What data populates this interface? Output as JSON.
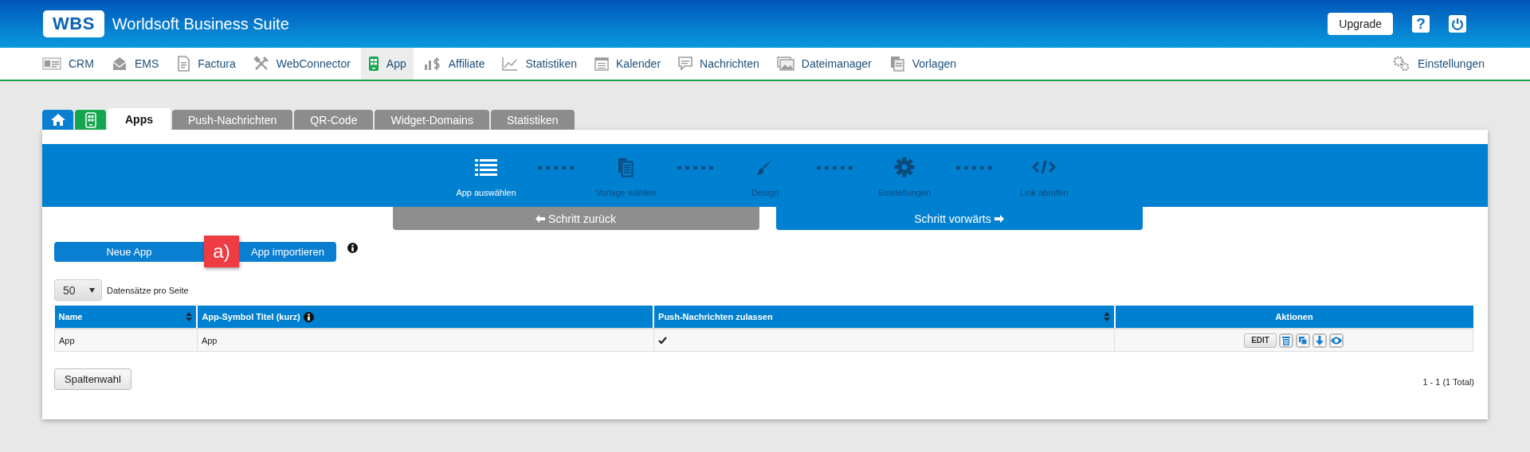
{
  "header": {
    "logo": "WBS",
    "title": "Worldsoft Business Suite",
    "upgrade": "Upgrade",
    "help": "?"
  },
  "nav": {
    "items": [
      {
        "label": "CRM",
        "kind": "card",
        "selected": false
      },
      {
        "label": "EMS",
        "kind": "mail",
        "selected": false
      },
      {
        "label": "Factura",
        "kind": "invoice",
        "selected": false
      },
      {
        "label": "WebConnector",
        "kind": "tools",
        "selected": false
      },
      {
        "label": "App",
        "kind": "phone",
        "selected": true
      },
      {
        "label": "Affiliate",
        "kind": "bars",
        "selected": false
      },
      {
        "label": "Statistiken",
        "kind": "chart",
        "selected": false
      },
      {
        "label": "Kalender",
        "kind": "calendar",
        "selected": false
      },
      {
        "label": "Nachrichten",
        "kind": "chat",
        "selected": false
      },
      {
        "label": "Dateimanager",
        "kind": "images",
        "selected": false
      },
      {
        "label": "Vorlagen",
        "kind": "docs",
        "selected": false
      }
    ],
    "settings": "Einstellungen"
  },
  "tabs": [
    {
      "kind": "home",
      "color": "#0a7fd2",
      "selected": false
    },
    {
      "kind": "phone",
      "color": "#17a650",
      "selected": false
    },
    {
      "kind": "text",
      "label": "Apps",
      "selected": true
    },
    {
      "kind": "text",
      "label": "Push-Nachrichten",
      "selected": false
    },
    {
      "kind": "text",
      "label": "QR-Code",
      "selected": false
    },
    {
      "kind": "text",
      "label": "Widget-Domains",
      "selected": false
    },
    {
      "kind": "text",
      "label": "Statistiken",
      "selected": false
    }
  ],
  "wizard": {
    "steps": [
      {
        "kind": "list",
        "label": "App auswählen",
        "active": true
      },
      {
        "kind": "docs",
        "label": "Vorlage wählen",
        "active": false
      },
      {
        "kind": "brush",
        "label": "Design",
        "active": false
      },
      {
        "kind": "gear",
        "label": "Einstellungen",
        "active": false
      },
      {
        "kind": "code",
        "label": "Link abrufen",
        "active": false
      }
    ],
    "back": {
      "label": "Schritt zurück",
      "disabled": true
    },
    "next": {
      "label": "Schritt vorwärts",
      "disabled": false
    }
  },
  "actions": {
    "new": "Neue App",
    "import": "App importieren",
    "annotation": "a)"
  },
  "page_size": {
    "value": "50",
    "label": "Datensätze pro Seite"
  },
  "table": {
    "columns": [
      {
        "label": "Name",
        "sortable": true,
        "info": false
      },
      {
        "label": "App-Symbol Titel (kurz)",
        "sortable": false,
        "info": true
      },
      {
        "label": "Push-Nachrichten zulassen",
        "sortable": true,
        "info": false
      },
      {
        "label": "Aktionen",
        "sortable": false,
        "info": false
      }
    ],
    "rows": [
      {
        "cells": [
          "App",
          "App"
        ],
        "push": true,
        "actions": [
          {
            "kind": "text",
            "label": "EDIT"
          },
          {
            "kind": "delete"
          },
          {
            "kind": "copy"
          },
          {
            "kind": "download"
          },
          {
            "kind": "view"
          }
        ]
      }
    ]
  },
  "column_choice": "Spaltenwahl",
  "pagination": "1 - 1 (1 Total)"
}
